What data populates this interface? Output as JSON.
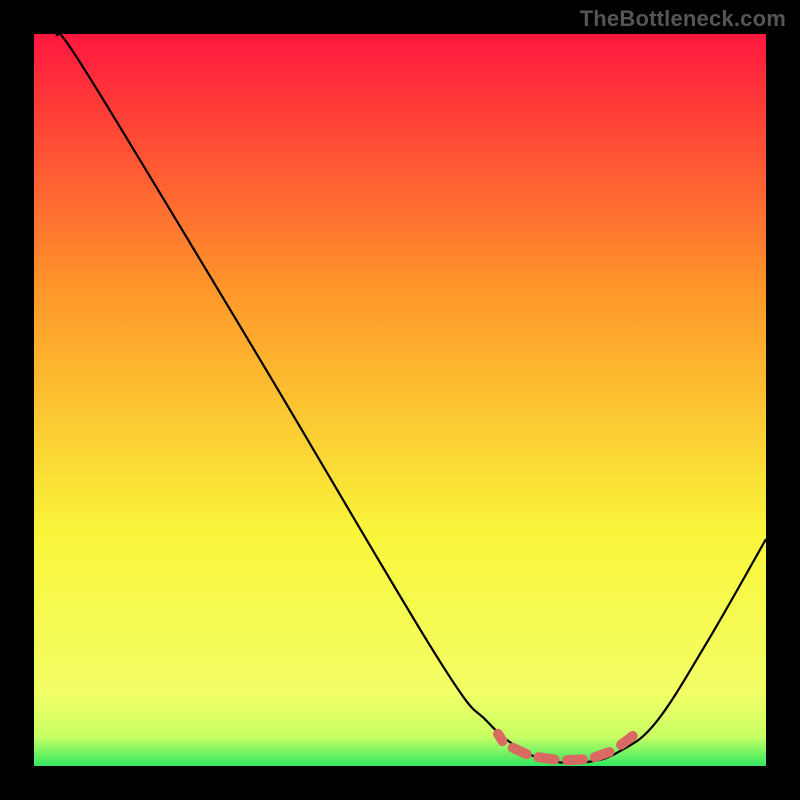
{
  "watermark": "TheBottleneck.com",
  "colors": {
    "red": "#ff173e",
    "orange": "#ff9a2a",
    "yellow": "#f9f53a",
    "palegreen": "#c8ff64",
    "green": "#32e861",
    "curve": "#000000",
    "dash": "#d96a61",
    "background": "#000000"
  },
  "chart_data": {
    "type": "line",
    "title": "",
    "xlabel": "",
    "ylabel": "",
    "xlim": [
      0,
      100
    ],
    "ylim": [
      0,
      100
    ],
    "grid": false,
    "curve_points": [
      {
        "x": 3,
        "y": 100
      },
      {
        "x": 7,
        "y": 95
      },
      {
        "x": 30,
        "y": 57
      },
      {
        "x": 55,
        "y": 15
      },
      {
        "x": 62,
        "y": 6
      },
      {
        "x": 67,
        "y": 2
      },
      {
        "x": 71,
        "y": 0.6
      },
      {
        "x": 76,
        "y": 0.6
      },
      {
        "x": 80,
        "y": 2
      },
      {
        "x": 85,
        "y": 6
      },
      {
        "x": 92,
        "y": 17
      },
      {
        "x": 100,
        "y": 31
      }
    ],
    "optimal_range": {
      "x_start": 63,
      "x_end": 82,
      "y": 0.9
    },
    "dash_segments": [
      {
        "x1": 63.4,
        "y1": 4.4,
        "x2": 64.0,
        "y2": 3.4
      },
      {
        "x1": 65.4,
        "y1": 2.5,
        "x2": 67.3,
        "y2": 1.6
      },
      {
        "x1": 68.9,
        "y1": 1.2,
        "x2": 71.1,
        "y2": 0.9
      },
      {
        "x1": 72.8,
        "y1": 0.8,
        "x2": 75.0,
        "y2": 0.9
      },
      {
        "x1": 76.6,
        "y1": 1.2,
        "x2": 78.6,
        "y2": 1.9
      },
      {
        "x1": 80.2,
        "y1": 2.9,
        "x2": 81.8,
        "y2": 4.1
      }
    ]
  }
}
